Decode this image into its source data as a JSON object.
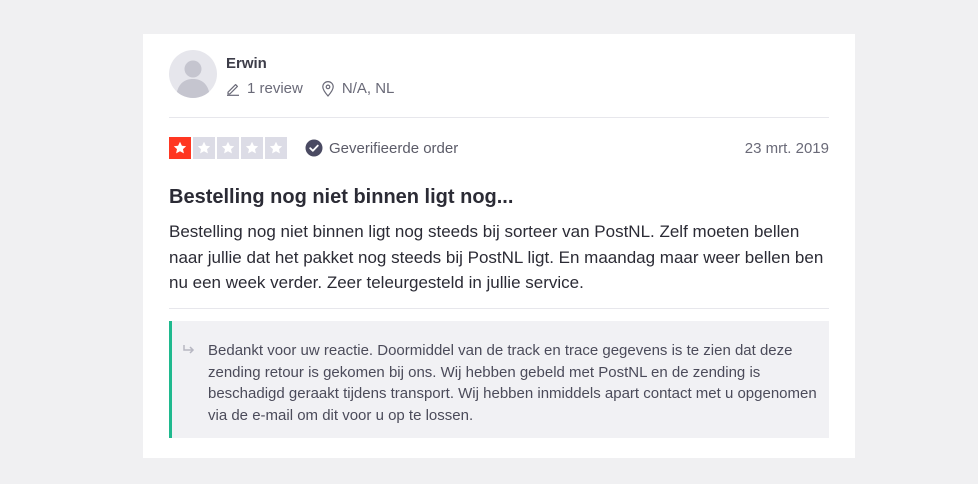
{
  "review": {
    "reviewer": {
      "name": "Erwin",
      "review_count": "1 review",
      "location": "N/A, NL",
      "avatar_icon": "user-silhouette-icon"
    },
    "rating": {
      "stars": 1,
      "max_stars": 5,
      "filled_color": "#ff3722",
      "empty_color": "#dcdce6"
    },
    "verified_label": "Geverifieerde order",
    "date": "23 mrt. 2019",
    "title": "Bestelling nog niet binnen ligt nog...",
    "body": "Bestelling nog niet binnen ligt nog steeds bij sorteer van PostNL. Zelf moeten bellen naar jullie dat het pakket nog steeds bij PostNL ligt. En maandag maar weer bellen ben nu een week verder. Zeer teleurgesteld in jullie service.",
    "reply": {
      "text": "Bedankt voor uw reactie. Doormiddel van de track en trace gegevens is te zien dat deze zending retour is gekomen bij ons. Wij hebben gebeld met PostNL en de zending is beschadigd geraakt tijdens transport. Wij hebben inmiddels apart contact met u opgenomen via de e-mail om dit voor u op te lossen.",
      "accent_color": "#1fb98e",
      "icon": "reply-arrow-icon"
    }
  }
}
